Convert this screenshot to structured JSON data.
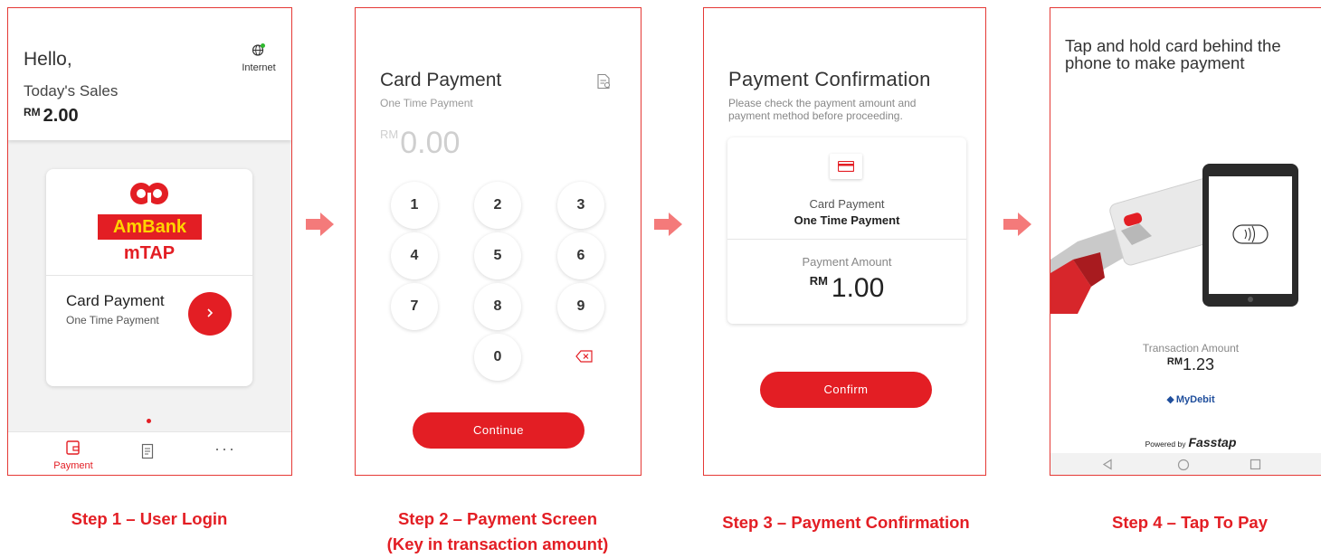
{
  "colors": {
    "brand_red": "#e31e24",
    "arrow": "#f47a7a",
    "logo_yellow": "#ffd400"
  },
  "screen1": {
    "greeting": "Hello,",
    "sales_label": "Today's Sales",
    "sales_currency": "RM",
    "sales_value": "2.00",
    "internet_label": "Internet",
    "logo_text": "AmBank",
    "product_name": "mTAP",
    "card_title": "Card Payment",
    "card_subtitle": "One Time Payment",
    "nav_payment_label": "Payment"
  },
  "screen2": {
    "title": "Card Payment",
    "subtitle": "One Time Payment",
    "amount_currency": "RM",
    "amount_value": "0.00",
    "keys": [
      "1",
      "2",
      "3",
      "4",
      "5",
      "6",
      "7",
      "8",
      "9",
      "0"
    ],
    "continue_label": "Continue"
  },
  "screen3": {
    "title": "Payment Confirmation",
    "subtitle": "Please check the payment amount and payment method before proceeding.",
    "method_label": "Card Payment",
    "method_sub": "One Time Payment",
    "amount_label": "Payment Amount",
    "amount_currency": "RM",
    "amount_value": "1.00",
    "confirm_label": "Confirm"
  },
  "screen4": {
    "title": "Tap and hold card behind the phone to make payment",
    "amount_label": "Transaction Amount",
    "amount_currency": "RM",
    "amount_value": "1.23",
    "network_logo": "MyDebit",
    "powered_prefix": "Powered by",
    "powered_brand": "Fasstap"
  },
  "captions": {
    "step1": "Step 1 – User Login",
    "step2_line1": "Step 2 – Payment Screen",
    "step2_line2": "(Key in transaction amount)",
    "step3": "Step 3 – Payment Confirmation",
    "step4": "Step 4 – Tap To Pay"
  }
}
